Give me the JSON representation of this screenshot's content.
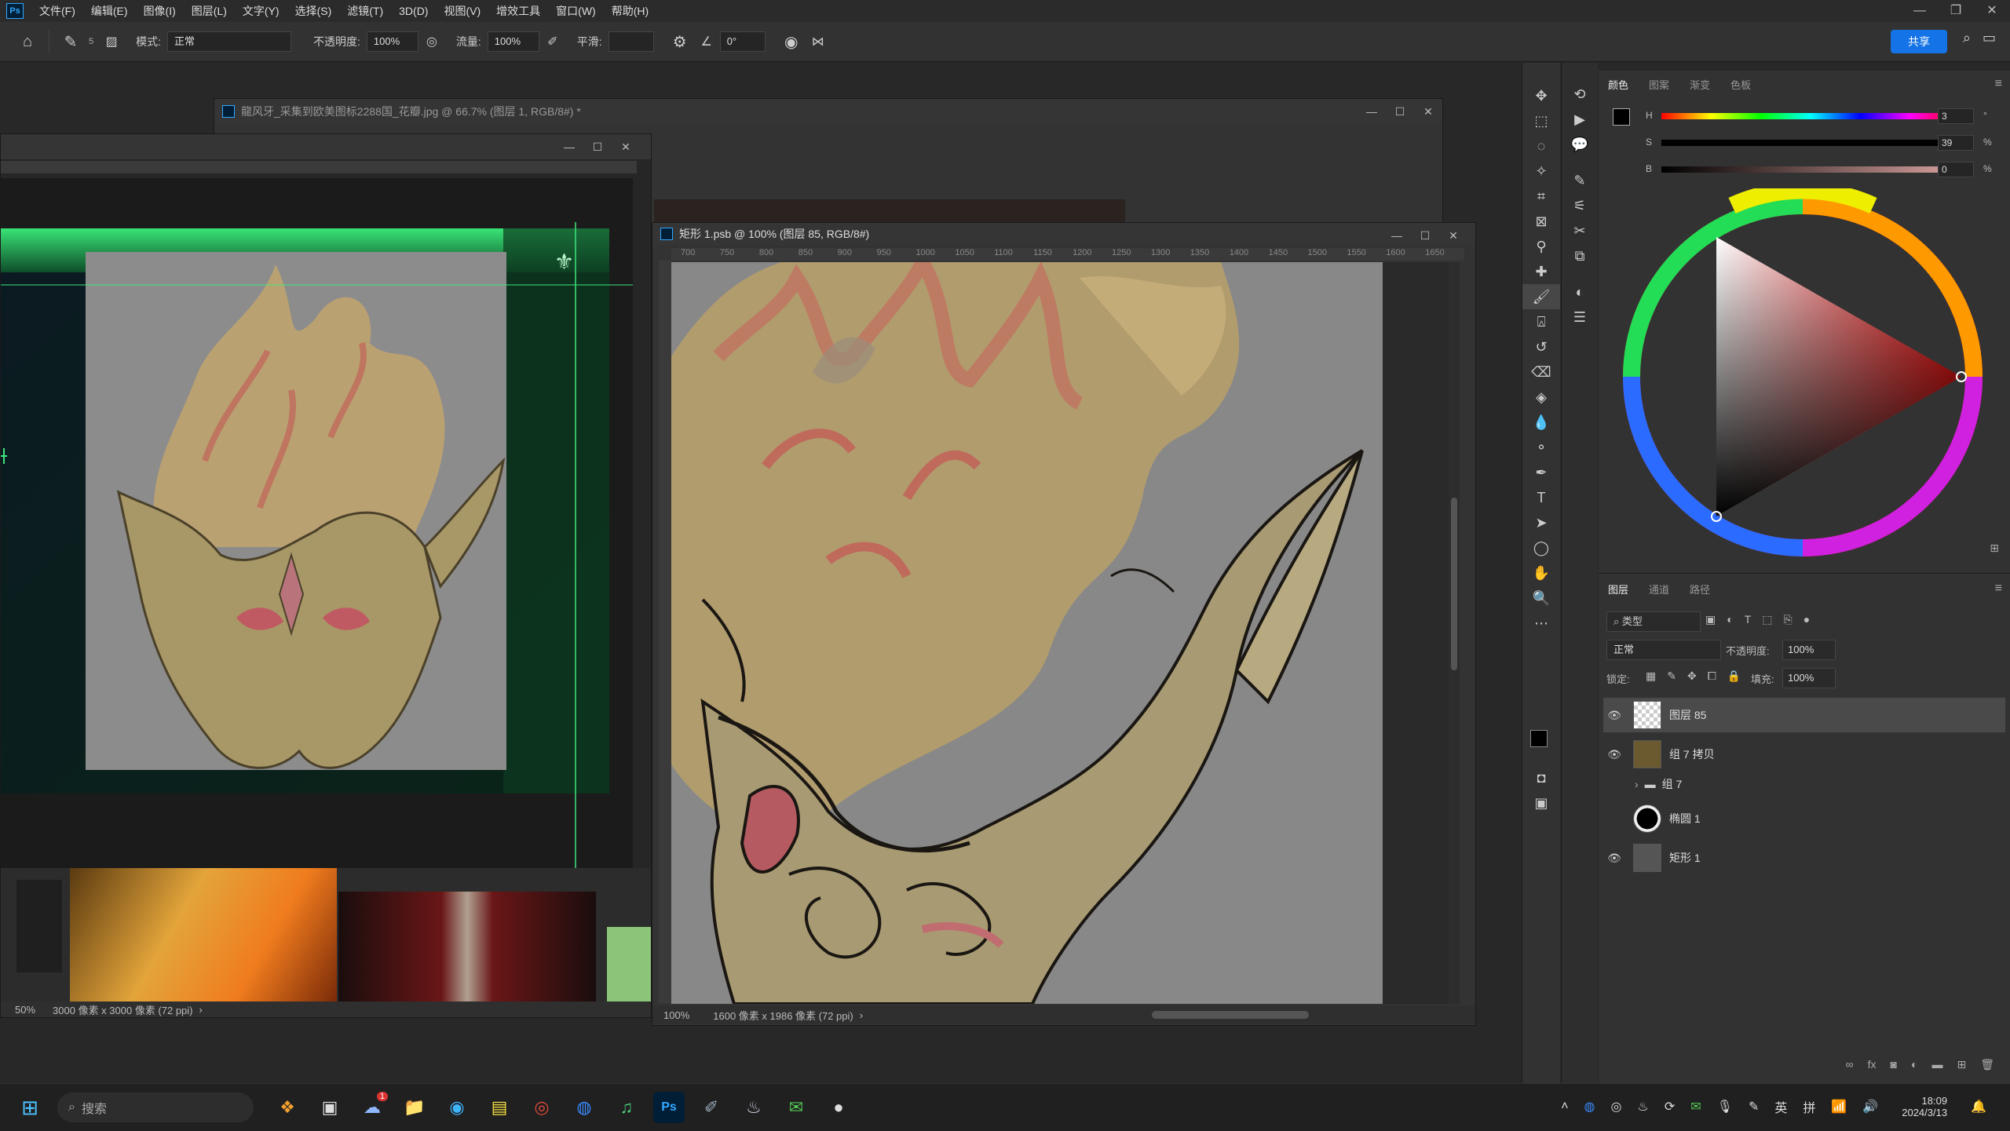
{
  "menubar": {
    "items": [
      "文件(F)",
      "编辑(E)",
      "图像(I)",
      "图层(L)",
      "文字(Y)",
      "选择(S)",
      "滤镜(T)",
      "3D(D)",
      "视图(V)",
      "增效工具",
      "窗口(W)",
      "帮助(H)"
    ],
    "logo": "Ps"
  },
  "optionsbar": {
    "brush_size": "5",
    "mode_label": "模式:",
    "mode_value": "正常",
    "opacity_label": "不透明度:",
    "opacity_value": "100%",
    "flow_label": "流量:",
    "flow_value": "100%",
    "smooth_label": "平滑:",
    "angle_value": "0°",
    "share_label": "共享"
  },
  "doc_back": {
    "title": "龍风牙_采集到欧美图标2288国_花瓣.jpg @ 66.7% (图层 1, RGB/8#) *"
  },
  "doc_left": {
    "zoom": "50%",
    "size": "3000 像素 x 3000 像素 (72 ppi)"
  },
  "doc_main": {
    "title": "矩形 1.psb @ 100% (图层 85, RGB/8#)",
    "zoom": "100%",
    "size": "1600 像素 x 1986 像素 (72 ppi)",
    "ruler_marks": [
      "700",
      "750",
      "800",
      "850",
      "900",
      "950",
      "1000",
      "1050",
      "1100",
      "1150",
      "1200",
      "1250",
      "1300",
      "1350",
      "1400",
      "1450",
      "1500",
      "1550",
      "1600",
      "1650"
    ]
  },
  "colorpanel": {
    "tabs": [
      "颜色",
      "图案",
      "渐变",
      "色板"
    ],
    "h_label": "H",
    "h_value": "3",
    "h_unit": "°",
    "s_label": "S",
    "s_value": "39",
    "s_unit": "%",
    "b_label": "B",
    "b_value": "0",
    "b_unit": "%"
  },
  "layerpanel": {
    "tabs": [
      "图层",
      "通道",
      "路径"
    ],
    "filter_label": "类型",
    "blend_mode": "正常",
    "opacity_label": "不透明度:",
    "opacity_value": "100%",
    "lock_label": "锁定:",
    "fill_label": "填充:",
    "fill_value": "100%",
    "layers": [
      {
        "name": "图层 85",
        "visible": true,
        "selected": true
      },
      {
        "name": "组 7 拷贝",
        "visible": true,
        "selected": false
      },
      {
        "name": "组 7",
        "visible": false,
        "selected": false
      },
      {
        "name": "椭圆 1",
        "visible": false,
        "selected": false
      },
      {
        "name": "矩形 1",
        "visible": true,
        "selected": false
      }
    ]
  },
  "taskbar": {
    "search_placeholder": "搜索",
    "badge_count": "1",
    "time": "18:09",
    "date": "2024/3/13",
    "ime_lang": "英",
    "ime_mode": "拼"
  },
  "colors": {
    "accent": "#1473e6",
    "foreground_swatch": "#000000",
    "background_swatch": "#ffffff",
    "canvas_gray": "#888888",
    "green_banner": "#2fd36a"
  }
}
